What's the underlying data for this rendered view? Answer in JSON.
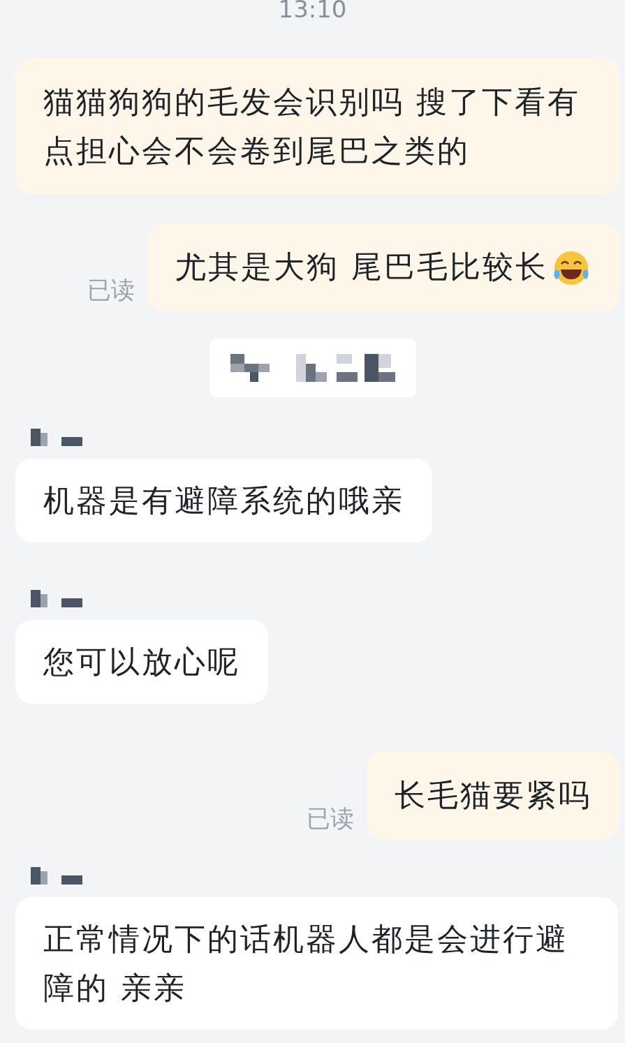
{
  "messages": [
    {
      "kind": "time",
      "text": "13:10"
    },
    {
      "kind": "outgoing",
      "text": "猫猫狗狗的毛发会识别吗 搜了下看有点担心会不会卷到尾巴之类的",
      "emoji": false
    },
    {
      "kind": "outgoing",
      "text": "尤其是大狗 尾巴毛比较长",
      "read_label": "已读",
      "emoji": true
    },
    {
      "kind": "redacted"
    },
    {
      "kind": "incoming",
      "text": "机器是有避障系统的哦亲"
    },
    {
      "kind": "incoming",
      "text": "您可以放心呢"
    },
    {
      "kind": "outgoing",
      "text": "长毛猫要紧吗",
      "read_label": "已读",
      "emoji": false
    },
    {
      "kind": "incoming",
      "text": "正常情况下的话机器人都是会进行避障的 亲亲"
    }
  ]
}
